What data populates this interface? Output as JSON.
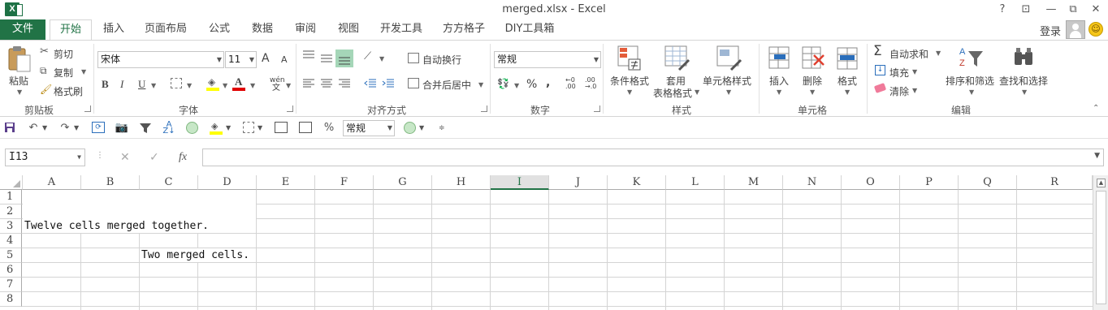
{
  "window": {
    "title": "merged.xlsx - Excel",
    "help_label": "?",
    "controls": [
      "?",
      "⧉",
      "—",
      "❐",
      "✕"
    ]
  },
  "tabs": [
    "文件",
    "开始",
    "插入",
    "页面布局",
    "公式",
    "数据",
    "审阅",
    "视图",
    "开发工具",
    "方方格子",
    "DIY工具箱"
  ],
  "active_tab": "开始",
  "login_label": "登录",
  "ribbon": {
    "clipboard": {
      "paste": "粘贴",
      "cut": "剪切",
      "copy": "复制",
      "format_painter": "格式刷",
      "label": "剪贴板"
    },
    "font": {
      "name": "宋体",
      "size": "11",
      "grow": "A",
      "shrink": "A",
      "bold": "B",
      "italic": "I",
      "underline": "U",
      "font_color": "A",
      "phonetic": "wén",
      "label": "字体"
    },
    "alignment": {
      "wrap_text": "自动换行",
      "merge_center": "合并后居中",
      "label": "对齐方式"
    },
    "number": {
      "format": "常规",
      "percent": "%",
      "comma": ",",
      "label": "数字"
    },
    "styles": {
      "conditional": "条件格式",
      "table_format_1": "套用",
      "table_format_2": "表格格式",
      "cell_styles": "单元格样式",
      "label": "样式"
    },
    "cells": {
      "insert": "插入",
      "delete": "删除",
      "format": "格式",
      "label": "单元格"
    },
    "editing": {
      "autosum": "自动求和",
      "fill": "填充",
      "clear": "清除",
      "sort_filter": "排序和筛选",
      "find_select": "查找和选择",
      "label": "编辑"
    }
  },
  "qat": {
    "format_value": "常规",
    "percent": "%"
  },
  "formula_bar": {
    "name_box": "I13",
    "cancel": "✕",
    "enter": "✓",
    "fx": "fx",
    "content": ""
  },
  "sheet": {
    "columns": [
      "A",
      "B",
      "C",
      "D",
      "E",
      "F",
      "G",
      "H",
      "I",
      "J",
      "K",
      "L",
      "M",
      "N",
      "O",
      "P",
      "Q",
      "R"
    ],
    "selected_column": "I",
    "rows": [
      "1",
      "2",
      "3",
      "4",
      "5",
      "6",
      "7",
      "8"
    ],
    "cells": {
      "merged_twelve": "Twelve cells merged together.",
      "merged_two": "Two merged cells."
    }
  },
  "colors": {
    "excel_green": "#217346",
    "border": "#d4d4d4"
  }
}
